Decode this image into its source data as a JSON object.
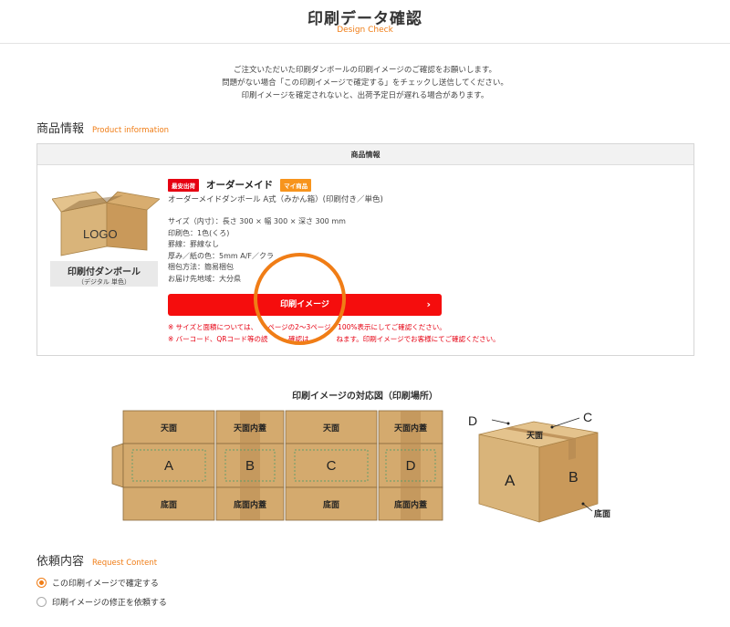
{
  "header": {
    "title": "印刷データ確認",
    "subtitle": "Design Check"
  },
  "intro": {
    "line1": "ご注文いただいた印刷ダンボールの印刷イメージのご確認をお願いします。",
    "line2": "問題がない場合「この印刷イメージで確定する」をチェックし送信してください。",
    "line3": "印刷イメージを確定されないと、出荷予定日が遅れる場合があります。"
  },
  "product_section": {
    "title": "商品情報",
    "subtitle": "Product information"
  },
  "panel": {
    "head": "商品情報",
    "thumb_logo": "LOGO",
    "thumb_name": "印刷付ダンボール",
    "thumb_sub": "（デジタル 単色）",
    "badge_best": "最安出荷",
    "product_title": "オーダーメイド",
    "badge_my": "マイ商品",
    "product_desc": "オーダーメイドダンボール A式（みかん箱）(印刷付き／単色)",
    "specs": [
      "サイズ（内寸）：長さ 300 × 幅 300 × 深さ 300 mm",
      "印刷色：1色(くろ)",
      "罫線：罫線なし",
      "厚み／紙の色：5mm A/F／クラ",
      "梱包方法：簡易梱包",
      "お届け先地域：大分県"
    ],
    "print_button": "印刷イメージ",
    "notes": [
      "※ サイズと面積については、　　ページの2〜3ページ　100%表示にしてご確認ください。",
      "※ バーコード、QRコード等の読　　　確認は　　　　ねます。印刷イメージでお客様にてご確認ください。"
    ]
  },
  "diagram": {
    "title": "印刷イメージの対応図（印刷場所）",
    "top_labels": [
      "天面",
      "天面内蓋",
      "天面",
      "天面内蓋"
    ],
    "side_labels": [
      "A",
      "B",
      "C",
      "D"
    ],
    "bottom_labels": [
      "底面",
      "底面内蓋",
      "底面",
      "底面内蓋"
    ],
    "box3d": {
      "top": "天面",
      "front": "A",
      "side": "B",
      "label_d": "D",
      "label_c": "C",
      "label_bottom": "底面"
    }
  },
  "request_section": {
    "title": "依頼内容",
    "subtitle": "Request Content",
    "options": [
      {
        "label": "この印刷イメージで確定する",
        "selected": true
      },
      {
        "label": "印刷イメージの修正を依頼する",
        "selected": false
      }
    ]
  },
  "colors": {
    "accent": "#f07d16",
    "red": "#f50d0d",
    "cardboard": "#d4aa6e"
  }
}
